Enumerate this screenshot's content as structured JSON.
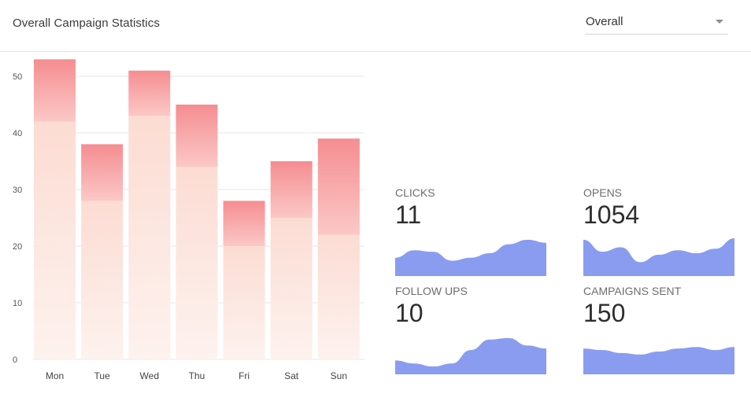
{
  "header": {
    "title": "Overall Campaign Statistics",
    "filter": {
      "selected": "Overall"
    }
  },
  "colors": {
    "bar_top": "#f58d91",
    "bar_top_light": "#fbc8c6",
    "bar_bottom": "#fcdcd3",
    "bar_bottom_light": "#fdf2ef",
    "sparkline": "#8a9cf0",
    "grid": "#e5e5e5"
  },
  "chart_data": {
    "type": "bar",
    "stacked": true,
    "categories": [
      "Mon",
      "Tue",
      "Wed",
      "Thu",
      "Fri",
      "Sat",
      "Sun"
    ],
    "series": [
      {
        "values": [
          42,
          28,
          43,
          34,
          20,
          25,
          22
        ]
      },
      {
        "values": [
          11,
          10,
          8,
          11,
          8,
          10,
          17
        ]
      }
    ],
    "ylim": [
      0,
      50
    ],
    "yticks": [
      0,
      10,
      20,
      30,
      40,
      50
    ],
    "grid": true
  },
  "stats": [
    {
      "label": "Clicks",
      "value": "11",
      "spark": [
        0.35,
        0.6,
        0.55,
        0.25,
        0.35,
        0.5,
        0.8,
        0.95,
        0.85
      ]
    },
    {
      "label": "Opens",
      "value": "1054",
      "spark": [
        0.95,
        0.55,
        0.7,
        0.2,
        0.45,
        0.6,
        0.5,
        0.65,
        1.0
      ]
    },
    {
      "label": "Follow ups",
      "value": "10",
      "spark": [
        0.2,
        0.1,
        0.0,
        0.1,
        0.55,
        0.9,
        0.95,
        0.7,
        0.6
      ]
    },
    {
      "label": "Campaigns sent",
      "value": "150",
      "spark": [
        0.6,
        0.55,
        0.45,
        0.4,
        0.5,
        0.6,
        0.65,
        0.55,
        0.65
      ]
    }
  ]
}
